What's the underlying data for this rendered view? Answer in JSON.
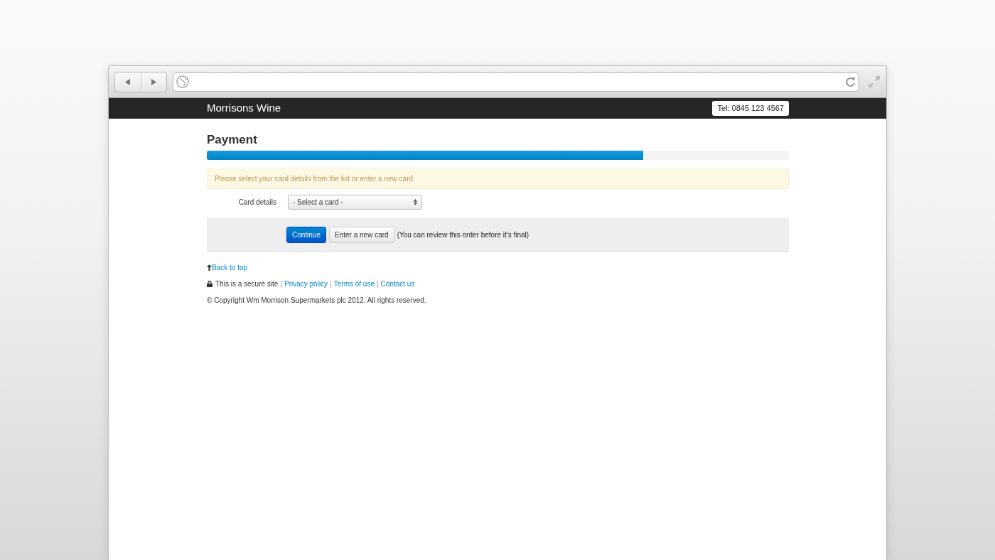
{
  "navbar": {
    "brand": "Morrisons Wine",
    "phone": "Tel: 0845 123 4567"
  },
  "page": {
    "title": "Payment",
    "progress": {
      "level": 0.75
    },
    "alert": "Please select your card details from the list or enter a new card.",
    "card_field": {
      "label": "Card details",
      "value": "- Select a card -"
    },
    "actions": {
      "primary": "Continue",
      "secondary": "Enter a new card",
      "note": "(You can review this order before it's final)"
    }
  },
  "footer": {
    "back_to_top": "Back to top",
    "secure_text": "This is a secure site",
    "links": [
      {
        "separator": "|",
        "label": "Privacy policy"
      },
      {
        "separator": "|",
        "label": "Terms of use"
      },
      {
        "separator": "|",
        "label": "Contact us"
      }
    ],
    "copyright": "© Copyright Wm Morrison Supermarkets plc 2012. All rights reserved."
  }
}
